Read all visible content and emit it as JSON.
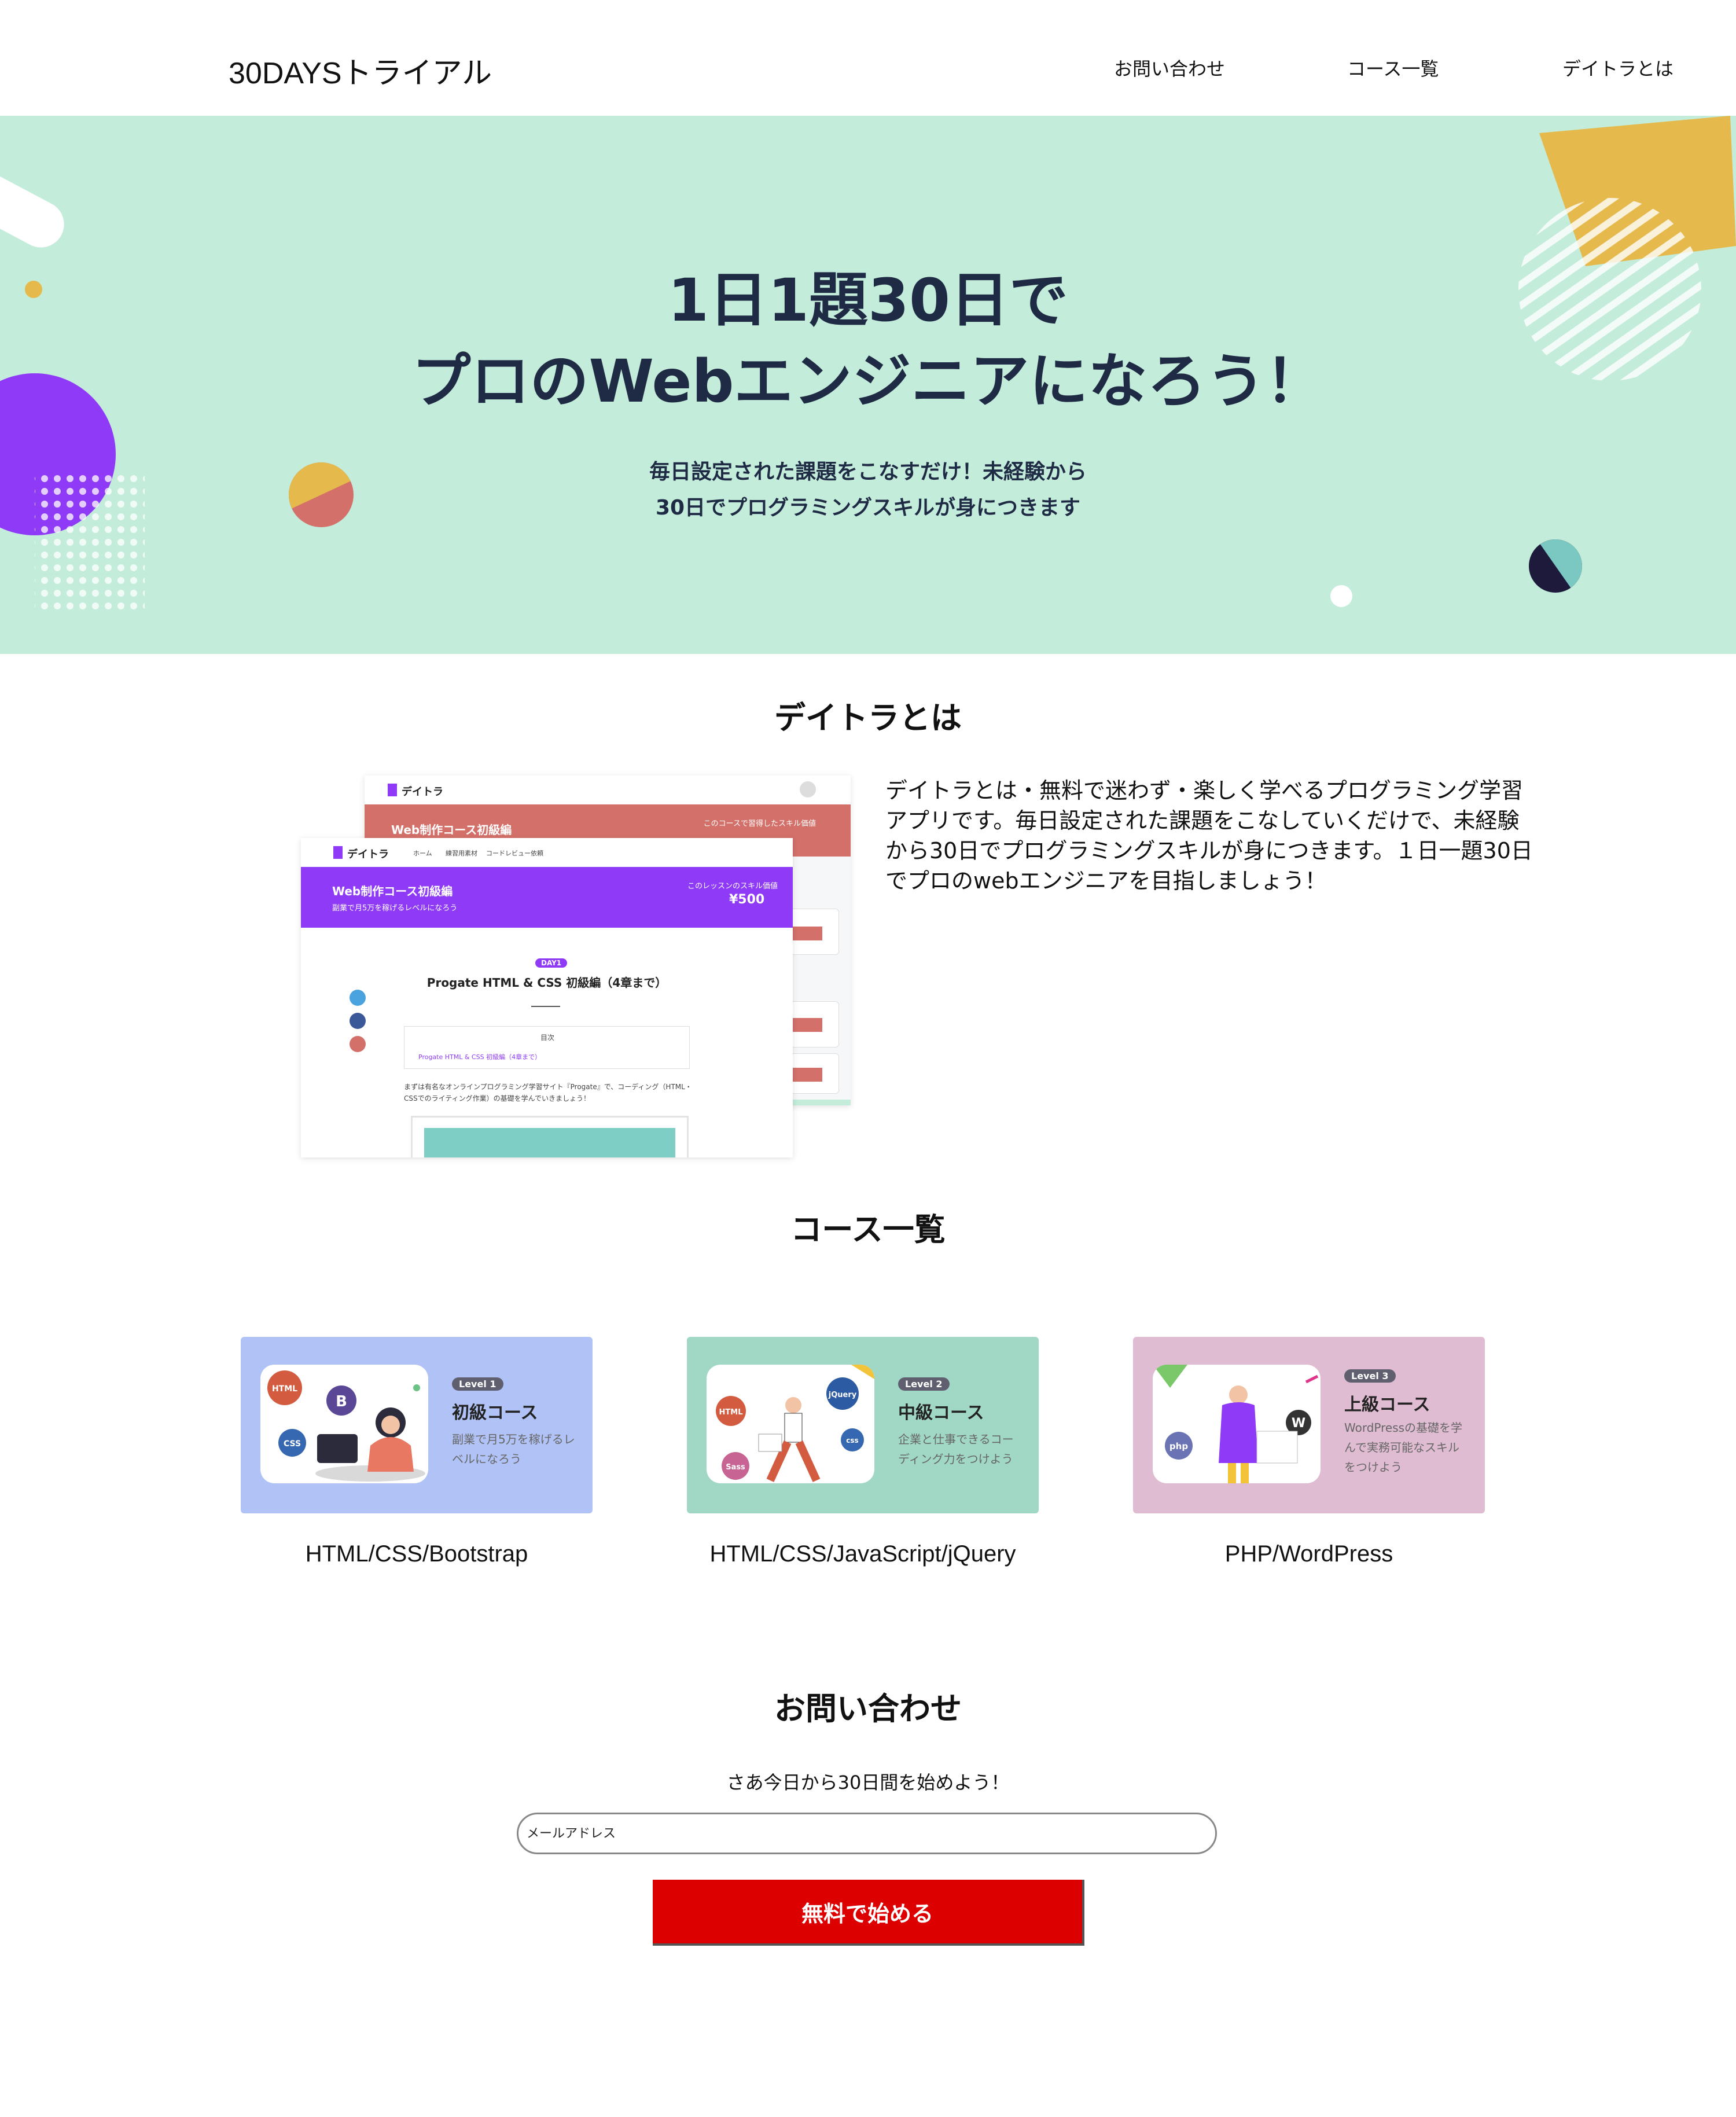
{
  "header": {
    "logo": "30DAYSトライアル",
    "nav": {
      "contact": "お問い合わせ",
      "courses": "コース一覧",
      "about": "デイトラとは"
    }
  },
  "hero": {
    "title_line1": "1日1題30日で",
    "title_line2": "プロのWebエンジニアになろう！",
    "sub_line1": "毎日設定された課題をこなすだけ！未経験から",
    "sub_line2": "30日でプログラミングスキルが身につきます"
  },
  "about": {
    "title": "デイトラとは",
    "text": "デイトラとは・無料で迷わず・楽しく学べるプログラミング学習アプリです。毎日設定された課題をこなしていくだけで、未経験から30日でプログラミングスキルが身につきます。１日一題30日でプロのwebエンジニアを目指しましょう！",
    "screenshot": {
      "back_brand": "デイトラ",
      "back_banner": "Web制作コース初級編",
      "back_banner_note": "このコースで習得したスキル価値",
      "front_brand": "デイトラ",
      "front_nav1": "ホーム",
      "front_nav2": "練習用素材",
      "front_nav3": "コードレビュー依頼",
      "front_banner": "Web制作コース初級編",
      "front_banner_sub": "副業で月5万を稼げるレベルになろう",
      "front_banner_note": "このレッスンのスキル価値",
      "front_price": "¥500",
      "day_badge": "DAY1",
      "lesson_title": "Progate HTML & CSS 初級編（4章まで）",
      "toc_label": "目次",
      "toc_item": "Progate HTML & CSS 初級編（4章まで）",
      "body_text": "まずは有名なオンラインプログラミング学習サイト『Progate』で、コーディング（HTML・CSSでのライティング作業）の基礎を学んでいきましょう！"
    }
  },
  "courses": {
    "title": "コース一覧",
    "items": [
      {
        "level": "Level 1",
        "name": "初級コース",
        "desc": "副業で月5万を稼げるレベルになろう",
        "label": "HTML/CSS/Bootstrap",
        "color": "#b1c3f6",
        "badges": [
          "HTML",
          "B",
          "CSS"
        ]
      },
      {
        "level": "Level 2",
        "name": "中級コース",
        "desc": "企業と仕事できるコーディング力をつけよう",
        "label": "HTML/CSS/JavaScript/jQuery",
        "color": "#a0d8c5",
        "badges": [
          "HTML",
          "jQuery",
          "Sass",
          "css"
        ]
      },
      {
        "level": "Level 3",
        "name": "上級コース",
        "desc": "WordPressの基礎を学んで実務可能なスキルをつけよう",
        "label": "PHP/WordPress",
        "color": "#e0bcd3",
        "badges": [
          "php",
          "W"
        ]
      }
    ]
  },
  "contact": {
    "title": "お問い合わせ",
    "lead": "さあ今日から30日間を始めよう！",
    "email_placeholder": "メールアドレス",
    "submit": "無料で始める"
  },
  "colors": {
    "hero_bg": "#c3ecda",
    "hero_text": "#1f2a44",
    "primary_purple": "#8e3af7",
    "salmon": "#d4706a",
    "cta_red": "#dd0000"
  }
}
